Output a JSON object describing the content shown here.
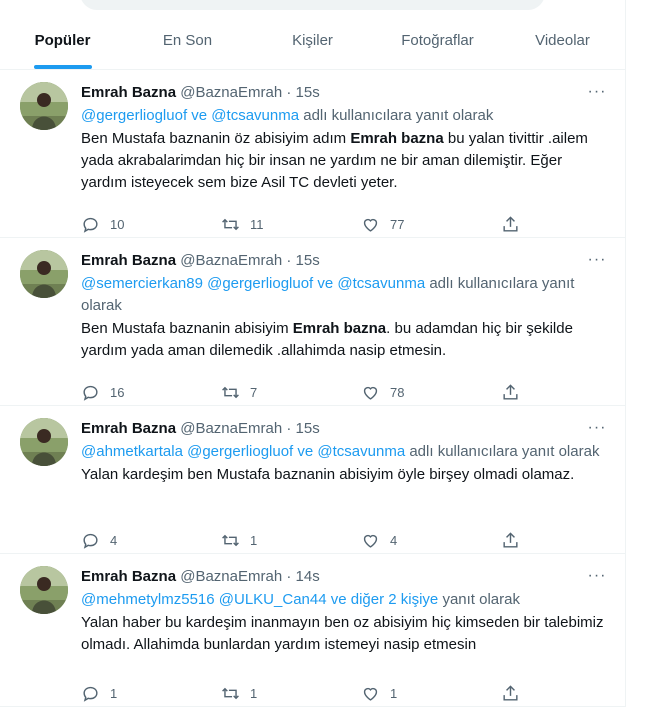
{
  "tabs": [
    {
      "label": "Popüler",
      "active": true
    },
    {
      "label": "En Son",
      "active": false
    },
    {
      "label": "Kişiler",
      "active": false
    },
    {
      "label": "Fotoğraflar",
      "active": false
    },
    {
      "label": "Videolar",
      "active": false
    }
  ],
  "accent_color": "#1d9bf0",
  "tweets": [
    {
      "name": "Emrah Bazna",
      "handle": "@BaznaEmrah",
      "dot": "·",
      "time": "15s",
      "reply_mentions": "@gergerliogluof ve @tcsavunma",
      "reply_suffix": " adlı kullanıcılara yanıt olarak",
      "body_pre": "Ben Mustafa baznanin öz abisiyim adım ",
      "body_bold": "Emrah bazna",
      "body_post": " bu yalan tivittir .ailem yada akrabalarimdan hiç bir insan ne yardım ne bir aman dilemiştir. Eğer yardım isteyecek sem bize Asil TC devleti yeter.",
      "replies": "10",
      "retweets": "11",
      "likes": "77"
    },
    {
      "name": "Emrah Bazna",
      "handle": "@BaznaEmrah",
      "dot": "·",
      "time": "15s",
      "reply_mentions": "@semercierkan89 @gergerliogluof ve @tcsavunma",
      "reply_suffix": " adlı kullanıcılara yanıt olarak",
      "body_pre": "Ben Mustafa baznanin abisiyim ",
      "body_bold": "Emrah bazna",
      "body_post": ".  bu adamdan hiç bir şekilde yardım yada aman dilemedik .allahimda nasip etmesin.",
      "replies": "16",
      "retweets": "7",
      "likes": "78"
    },
    {
      "name": "Emrah Bazna",
      "handle": "@BaznaEmrah",
      "dot": "·",
      "time": "15s",
      "reply_mentions": "@ahmetkartala @gergerliogluof ve @tcsavunma",
      "reply_suffix": " adlı kullanıcılara yanıt olarak",
      "body_pre": "Yalan kardeşim ben Mustafa baznanin abisiyim öyle birşey olmadi olamaz.",
      "body_bold": "",
      "body_post": "",
      "replies": "4",
      "retweets": "1",
      "likes": "4"
    },
    {
      "name": "Emrah Bazna",
      "handle": "@BaznaEmrah",
      "dot": "·",
      "time": "14s",
      "reply_mentions": "@mehmetylmz5516 @ULKU_Can44  ve diğer 2 kişiye",
      "reply_suffix": " yanıt olarak",
      "body_pre": "Yalan haber bu kardeşim inanmayın ben oz abisiyim hiç kimseden bir talebimiz olmadı. Allahimda bunlardan yardım istemeyi nasip etmesin",
      "body_bold": "",
      "body_post": "",
      "replies": "1",
      "retweets": "1",
      "likes": "1"
    }
  ],
  "icons": {
    "more": "more-dots-icon",
    "reply": "reply-bubble-icon",
    "retweet": "retweet-icon",
    "like": "heart-icon",
    "share": "share-upload-icon"
  }
}
